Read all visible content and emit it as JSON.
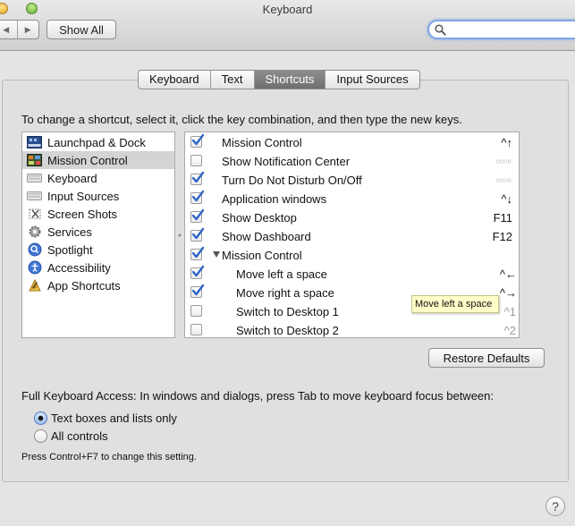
{
  "window": {
    "title": "Keyboard"
  },
  "toolbar": {
    "back_glyph": "◀",
    "forward_glyph": "▶",
    "show_all_label": "Show All",
    "search_value": "",
    "search_placeholder": ""
  },
  "tabs": [
    {
      "label": "Keyboard",
      "active": false
    },
    {
      "label": "Text",
      "active": false
    },
    {
      "label": "Shortcuts",
      "active": true
    },
    {
      "label": "Input Sources",
      "active": false
    }
  ],
  "instruction": "To change a shortcut, select it, click the key combination, and then type the new keys.",
  "categories": [
    {
      "label": "Launchpad & Dock",
      "icon": "launchpad-dock-icon",
      "selected": false
    },
    {
      "label": "Mission Control",
      "icon": "mission-control-icon",
      "selected": true
    },
    {
      "label": "Keyboard",
      "icon": "keyboard-icon",
      "selected": false
    },
    {
      "label": "Input Sources",
      "icon": "input-sources-icon",
      "selected": false
    },
    {
      "label": "Screen Shots",
      "icon": "screen-shots-icon",
      "selected": false
    },
    {
      "label": "Services",
      "icon": "services-gear-icon",
      "selected": false
    },
    {
      "label": "Spotlight",
      "icon": "spotlight-icon",
      "selected": false
    },
    {
      "label": "Accessibility",
      "icon": "accessibility-icon",
      "selected": false
    },
    {
      "label": "App Shortcuts",
      "icon": "app-shortcuts-icon",
      "selected": false
    }
  ],
  "shortcuts": [
    {
      "label": "Mission Control",
      "checked": true,
      "key": "^↑",
      "indent": 0
    },
    {
      "label": "Show Notification Center",
      "checked": false,
      "key": "none",
      "indent": 0
    },
    {
      "label": "Turn Do Not Disturb On/Off",
      "checked": true,
      "key": "none",
      "indent": 0
    },
    {
      "label": "Application windows",
      "checked": true,
      "key": "^↓",
      "indent": 0
    },
    {
      "label": "Show Desktop",
      "checked": true,
      "key": "F11",
      "indent": 0
    },
    {
      "label": "Show Dashboard",
      "checked": true,
      "key": "F12",
      "indent": 0
    },
    {
      "label": "Mission Control",
      "checked": true,
      "key": "",
      "indent": 0,
      "group": true
    },
    {
      "label": "Move left a space",
      "checked": true,
      "key": "^←",
      "indent": 1
    },
    {
      "label": "Move right a space",
      "checked": true,
      "key": "^→",
      "indent": 1
    },
    {
      "label": "Switch to Desktop 1",
      "checked": false,
      "key": "^1",
      "indent": 1
    },
    {
      "label": "Switch to Desktop 2",
      "checked": false,
      "key": "^2",
      "indent": 1
    }
  ],
  "tooltip": "Move left a space",
  "restore_label": "Restore Defaults",
  "full_keyboard_access": {
    "label": "Full Keyboard Access: In windows and dialogs, press Tab to move keyboard focus between:",
    "options": [
      {
        "label": "Text boxes and lists only",
        "selected": true
      },
      {
        "label": "All controls",
        "selected": false
      }
    ],
    "hint": "Press Control+F7 to change this setting."
  },
  "help_label": "?",
  "colors": {
    "selection_grey": "#d4d4d4",
    "checkbox_blue": "#2f66c9",
    "tooltip_yellow": "#fffdc8",
    "focus_ring": "#7fa7e6"
  }
}
